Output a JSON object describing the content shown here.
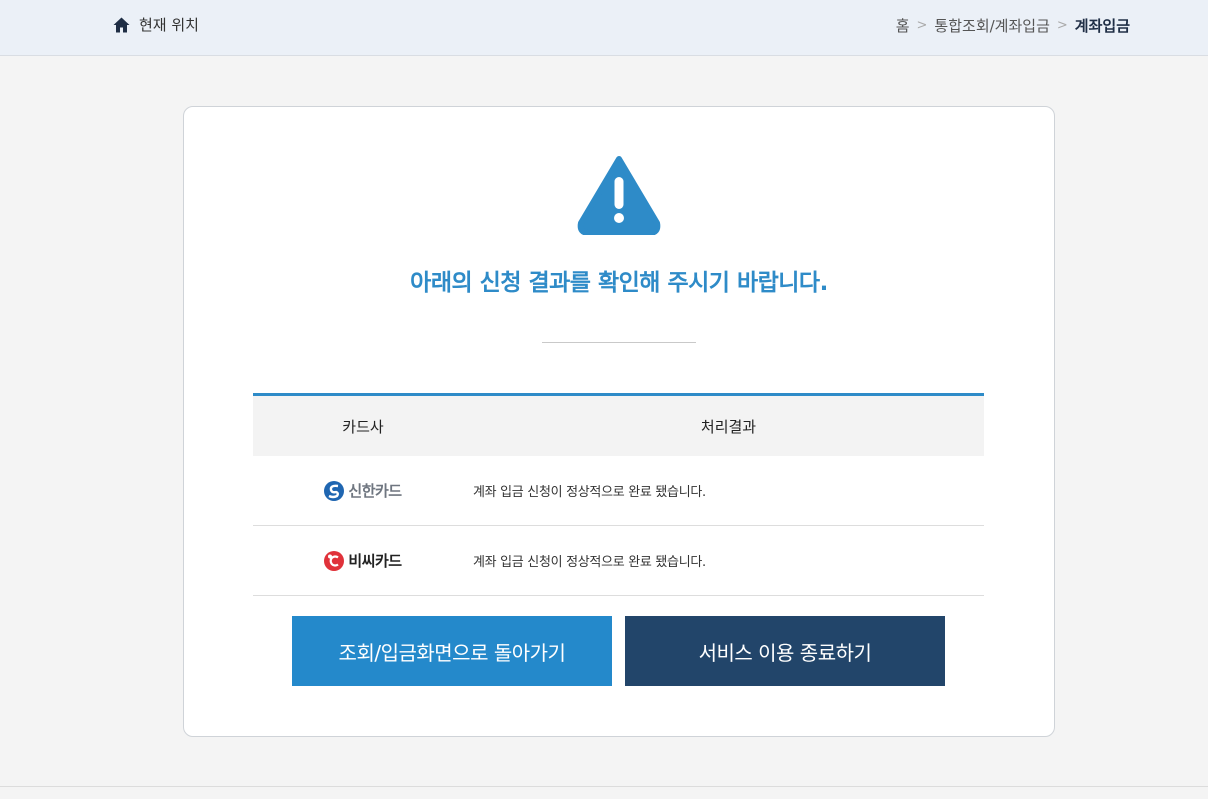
{
  "header": {
    "location_label": "현재 위치",
    "breadcrumb": {
      "home": "홈",
      "parent": "통합조회/계좌입금",
      "current": "계좌입금",
      "separator": ">"
    }
  },
  "result": {
    "message": "아래의 신청 결과를 확인해 주시기 바랍니다."
  },
  "table": {
    "headers": {
      "card_company": "카드사",
      "result": "처리결과"
    },
    "rows": [
      {
        "company": "신한카드",
        "result": "계좌 입금 신청이 정상적으로 완료 됐습니다."
      },
      {
        "company": "비씨카드",
        "result": "계좌 입금 신청이 정상적으로 완료 됐습니다."
      }
    ]
  },
  "buttons": {
    "back": "조회/입금화면으로 돌아가기",
    "exit": "서비스 이용 종료하기"
  },
  "colors": {
    "accent": "#2e8bc8",
    "primary_button": "#2489cb",
    "dark_button": "#22456a",
    "header_bg": "#ebf0f7"
  },
  "icons": {
    "location": "home-icon",
    "alert": "warning-triangle-icon"
  }
}
